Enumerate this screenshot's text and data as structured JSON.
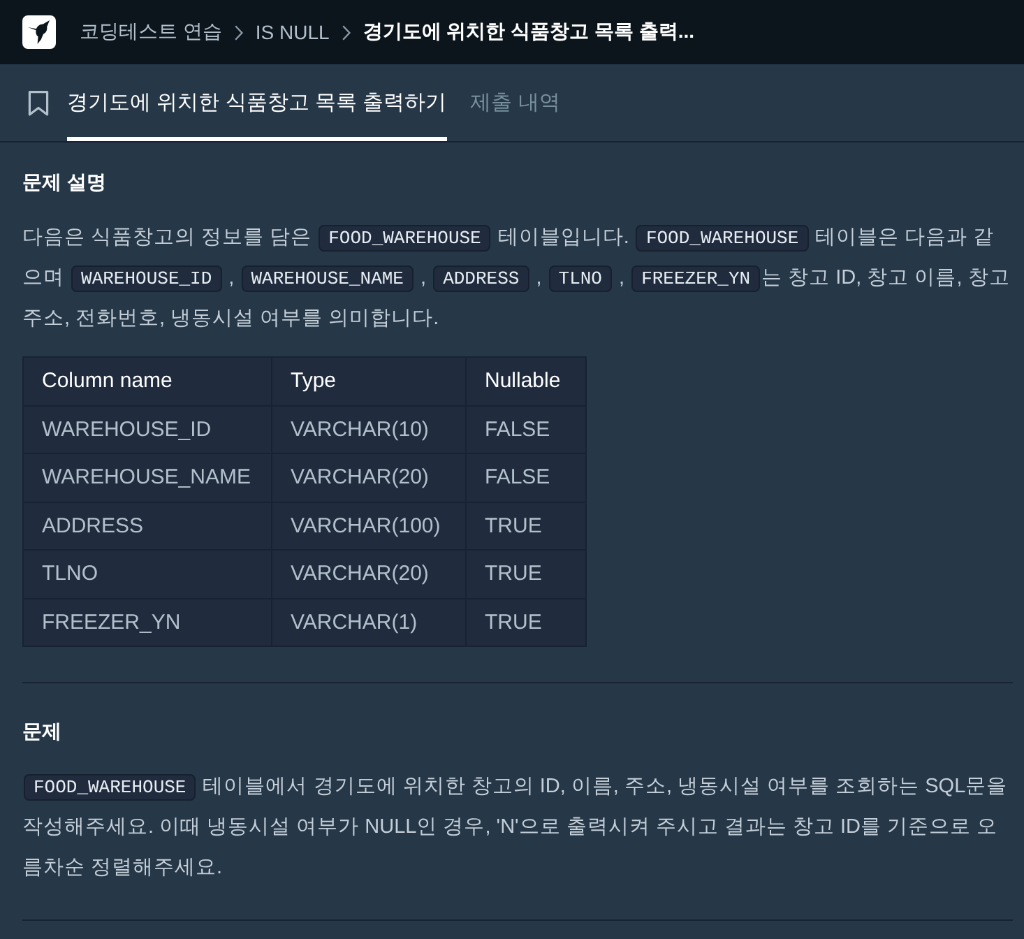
{
  "top_bar": {
    "breadcrumbs": [
      {
        "label": "코딩테스트 연습",
        "current": false
      },
      {
        "label": "IS NULL",
        "current": false
      },
      {
        "label": "경기도에 위치한 식품창고 목록 출력...",
        "current": true
      }
    ]
  },
  "tabs": [
    {
      "label": "경기도에 위치한 식품창고 목록 출력하기",
      "selected": true
    },
    {
      "label": "제출 내역",
      "selected": false
    }
  ],
  "sections": [
    {
      "heading": "문제 설명",
      "paragraph": [
        {
          "kind": "text",
          "text": "다음은 식품창고의 정보를 담은 "
        },
        {
          "kind": "code",
          "text": "FOOD_WAREHOUSE"
        },
        {
          "kind": "text",
          "text": " 테이블입니다. "
        },
        {
          "kind": "code",
          "text": "FOOD_WAREHOUSE"
        },
        {
          "kind": "text",
          "text": " 테이블은 다음과 같으며 "
        },
        {
          "kind": "code",
          "text": "WAREHOUSE_ID"
        },
        {
          "kind": "text",
          "text": " , "
        },
        {
          "kind": "code",
          "text": "WAREHOUSE_NAME"
        },
        {
          "kind": "text",
          "text": " , "
        },
        {
          "kind": "code",
          "text": "ADDRESS"
        },
        {
          "kind": "text",
          "text": " , "
        },
        {
          "kind": "code",
          "text": "TLNO"
        },
        {
          "kind": "text",
          "text": " , "
        },
        {
          "kind": "code",
          "text": "FREEZER_YN"
        },
        {
          "kind": "text",
          "text": "는 창고 ID, 창고 이름, 창고 주소, 전화번호, 냉동시설 여부를 의미합니다."
        }
      ],
      "table": {
        "columns": [
          "Column name",
          "Type",
          "Nullable"
        ],
        "rows": [
          [
            "WAREHOUSE_ID",
            "VARCHAR(10)",
            "FALSE"
          ],
          [
            "WAREHOUSE_NAME",
            "VARCHAR(20)",
            "FALSE"
          ],
          [
            "ADDRESS",
            "VARCHAR(100)",
            "TRUE"
          ],
          [
            "TLNO",
            "VARCHAR(20)",
            "TRUE"
          ],
          [
            "FREEZER_YN",
            "VARCHAR(1)",
            "TRUE"
          ]
        ]
      }
    },
    {
      "heading": "문제",
      "paragraph": [
        {
          "kind": "code",
          "text": "FOOD_WAREHOUSE"
        },
        {
          "kind": "text",
          "text": " 테이블에서 경기도에 위치한 창고의 ID, 이름, 주소, 냉동시설 여부를 조회하는 SQL문을 작성해주세요. 이때 냉동시설 여부가 NULL인 경우, 'N'으로 출력시켜 주시고 결과는 창고 ID를 기준으로 오름차순 정렬해주세요."
        }
      ]
    }
  ]
}
